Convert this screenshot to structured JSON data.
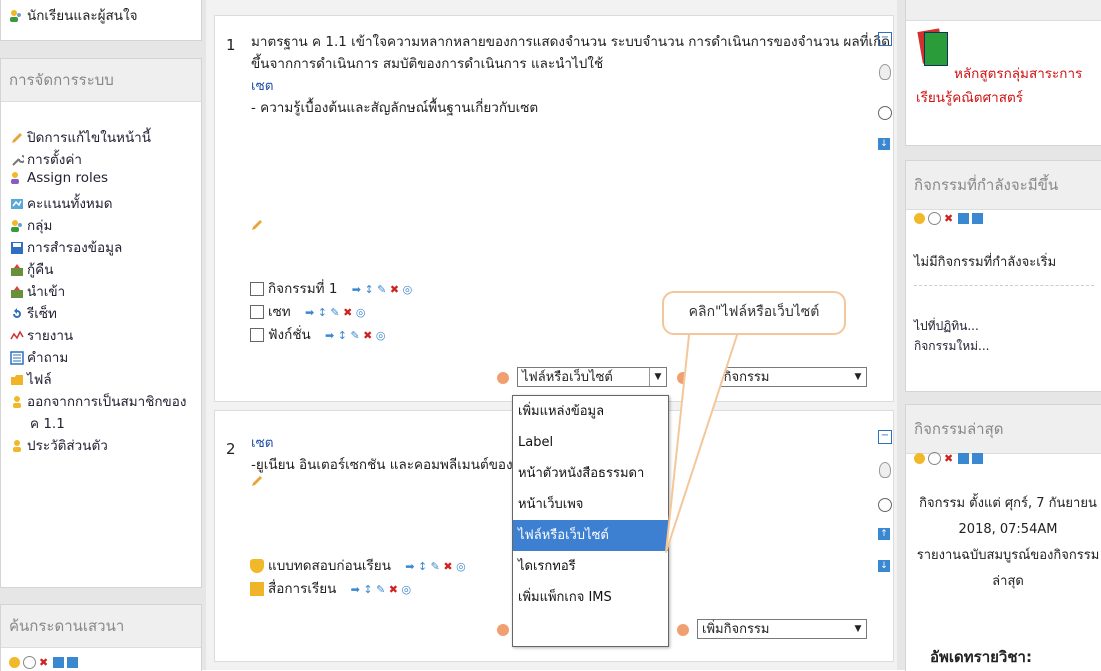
{
  "left": {
    "top_item": "นักเรียนและผู้สนใจ",
    "admin": {
      "title": "การจัดการระบบ",
      "items": [
        "ปิดการแก้ไขในหน้านี้",
        "การตั้งค่า",
        "Assign roles",
        "คะแนนทั้งหมด",
        "กลุ่ม",
        "การสำรองข้อมูล",
        "กู้คืน",
        "นำเข้า",
        "รีเซ็ท",
        "รายงาน",
        "คำถาม",
        "ไฟล์",
        "ออกจากการเป็นสมาชิกของ",
        "ค 1.1",
        "ประวัติส่วนตัว"
      ]
    },
    "forum_title": "ค้นกระดานเสวนา"
  },
  "center": {
    "s1": {
      "num": "1",
      "line1": "มาตรฐาน ค 1.1 เข้าใจความหลากหลายของการแสดงจำนวน ระบบจำนวน การดำเนินการของจำนวน ผลที่เกิด",
      "line2": "ขึ้นจากการดำเนินการ สมบัติของการดำเนินการ และนำไปใช้",
      "sub": "เซต",
      "desc": "- ความรู้เบื้องต้นและสัญลักษณ์พื้นฐานเกี่ยวกับเซต",
      "acts": [
        "กิจกรรมที่ 1",
        "เซท",
        "ฟังก์ชั่น"
      ]
    },
    "s2": {
      "num": "2",
      "sub": "เซต",
      "desc": "-ยูเนียน อินเตอร์เซกชัน และคอมพลีเมนต์ของเ",
      "acts": [
        "แบบทดสอบก่อนเรียน",
        "สื่อการเรียน"
      ]
    },
    "select_res": "ไฟล์หรือเว็บไซต์",
    "select_act": "เพิ่มกิจกรรม",
    "select_act2": "เพิ่มกิจกรรม",
    "dropdown": [
      "เพิ่มแหล่งข้อมูล",
      "Label",
      "หน้าตัวหนังสือธรรมดา",
      "หน้าเว็บเพจ",
      "ไฟล์หรือเว็บไซต์",
      "ไดเรกทอรี",
      "เพิ่มแพ็กเกจ IMS"
    ],
    "dropdown_selected_index": 4,
    "callout": "คลิก\"ไฟล์หรือเว็บไซต์"
  },
  "right": {
    "course_link": "หลักสูตรกลุ่มสาระการเรียนรู้คณิตศาสตร์",
    "course_l1": "หลักสูตรกลุ่มสาระการ",
    "course_l2": "เรียนรู้คณิตศาสตร์",
    "upcoming_title": "กิจกรรมที่กำลังจะมีขึ้น",
    "upcoming_none": "ไม่มีกิจกรรมที่กำลังจะเริ่ม",
    "goto_cal": "ไปที่ปฏิทิน...",
    "new_event": "กิจกรรมใหม่...",
    "recent_title": "กิจกรรมล่าสุด",
    "recent_since": "กิจกรรม ตั้งแต่ ศุกร์, 7 กันยายน",
    "recent_date": "2018, 07:54AM",
    "full_report_1": "รายงานฉบับสมบูรณ์ของกิจกรรม",
    "full_report_2": "ล่าสุด",
    "update_title": "อัพเดทรายวิชา:"
  }
}
